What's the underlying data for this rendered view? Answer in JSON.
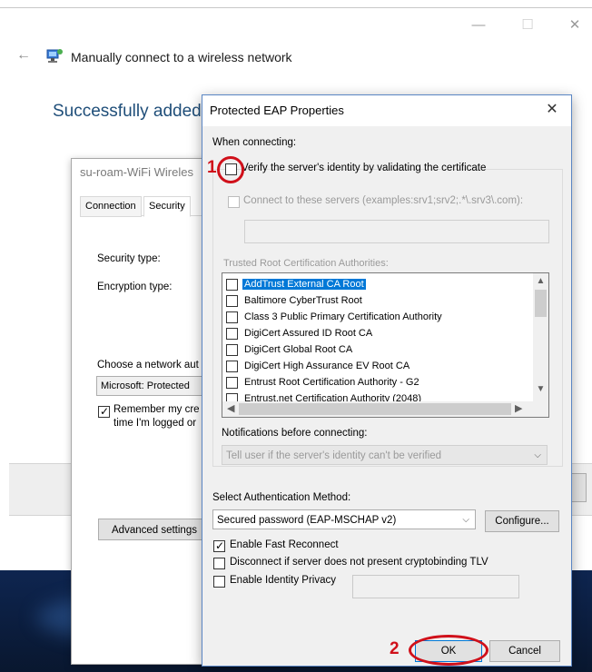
{
  "wizard": {
    "title": "Manually connect to a wireless network",
    "success_text": "Successfully added su",
    "icons": {
      "back": "back-arrow-icon",
      "network": "wireless-network-icon",
      "minimize": "minimize-icon",
      "maximize": "maximize-icon",
      "close": "close-icon"
    }
  },
  "wireless_props": {
    "title": "su-roam-WiFi Wireles",
    "tabs": [
      "Connection",
      "Security"
    ],
    "active_tab": "Security",
    "security_type_label": "Security type:",
    "encryption_type_label": "Encryption type:",
    "choose_auth_label": "Choose a network aut",
    "auth_method_value": "Microsoft: Protected",
    "remember_line1": "Remember my cre",
    "remember_line2": "time I'm logged or",
    "remember_checked": true,
    "advanced_button": "Advanced settings"
  },
  "peap": {
    "title": "Protected EAP Properties",
    "when_connecting": "When connecting:",
    "verify_label": "Verify the server's identity by validating the certificate",
    "verify_checked": false,
    "connect_servers_label": "Connect to these servers (examples:srv1;srv2;.*\\.srv3\\.com):",
    "trusted_ca_label": "Trusted Root Certification Authorities:",
    "ca_list": [
      {
        "name": "AddTrust External CA Root",
        "checked": false,
        "selected": true
      },
      {
        "name": "Baltimore CyberTrust Root",
        "checked": false,
        "selected": false
      },
      {
        "name": "Class 3 Public Primary Certification Authority",
        "checked": false,
        "selected": false
      },
      {
        "name": "DigiCert Assured ID Root CA",
        "checked": false,
        "selected": false
      },
      {
        "name": "DigiCert Global Root CA",
        "checked": false,
        "selected": false
      },
      {
        "name": "DigiCert High Assurance EV Root CA",
        "checked": false,
        "selected": false
      },
      {
        "name": "Entrust Root Certification Authority - G2",
        "checked": false,
        "selected": false
      },
      {
        "name": "Entrust.net Certification Authority (2048)",
        "checked": false,
        "selected": false
      }
    ],
    "notifications_label": "Notifications before connecting:",
    "notifications_value": "Tell user if the server's identity can't be verified",
    "select_auth_label": "Select Authentication Method:",
    "auth_method_value": "Secured password (EAP-MSCHAP v2)",
    "configure_button": "Configure...",
    "fast_reconnect_label": "Enable Fast Reconnect",
    "fast_reconnect_checked": true,
    "disconnect_label": "Disconnect if server does not present cryptobinding TLV",
    "disconnect_checked": false,
    "identity_privacy_label": "Enable Identity Privacy",
    "identity_privacy_checked": false,
    "ok_button": "OK",
    "cancel_button": "Cancel"
  },
  "annotations": {
    "step1": "1",
    "step2": "2",
    "color": "#d0101a"
  }
}
